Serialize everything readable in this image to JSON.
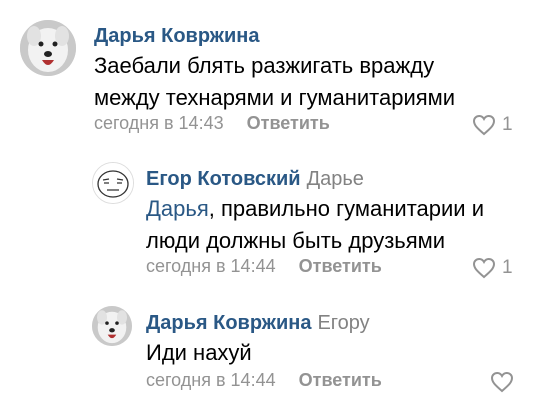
{
  "comments": [
    {
      "author": "Дарья Ковржина",
      "reply_to": "",
      "mention": "",
      "text_line1": "Заебали блять разжигать вражду",
      "text_line2": "между технарями и гуманитариями",
      "time": "сегодня в 14:43",
      "reply_label": "Ответить",
      "likes": "1",
      "avatar_icon": "dog-face-avatar"
    },
    {
      "author": "Егор Котовский",
      "reply_to": "Дарье",
      "mention": "Дарья",
      "text_line1_rest": ", правильно гуманитарии и",
      "text_line2": "люди должны быть друзьями",
      "time": "сегодня в 14:44",
      "reply_label": "Ответить",
      "likes": "1",
      "avatar_icon": "meme-face-avatar"
    },
    {
      "author": "Дарья Ковржина",
      "reply_to": "Егору",
      "mention": "",
      "text_line1": "Иди нахуй",
      "time": "сегодня в 14:44",
      "reply_label": "Ответить",
      "likes": "",
      "avatar_icon": "dog-face-avatar"
    }
  ],
  "colors": {
    "author": "#2a5885",
    "meta": "#939393",
    "text": "#000000"
  }
}
